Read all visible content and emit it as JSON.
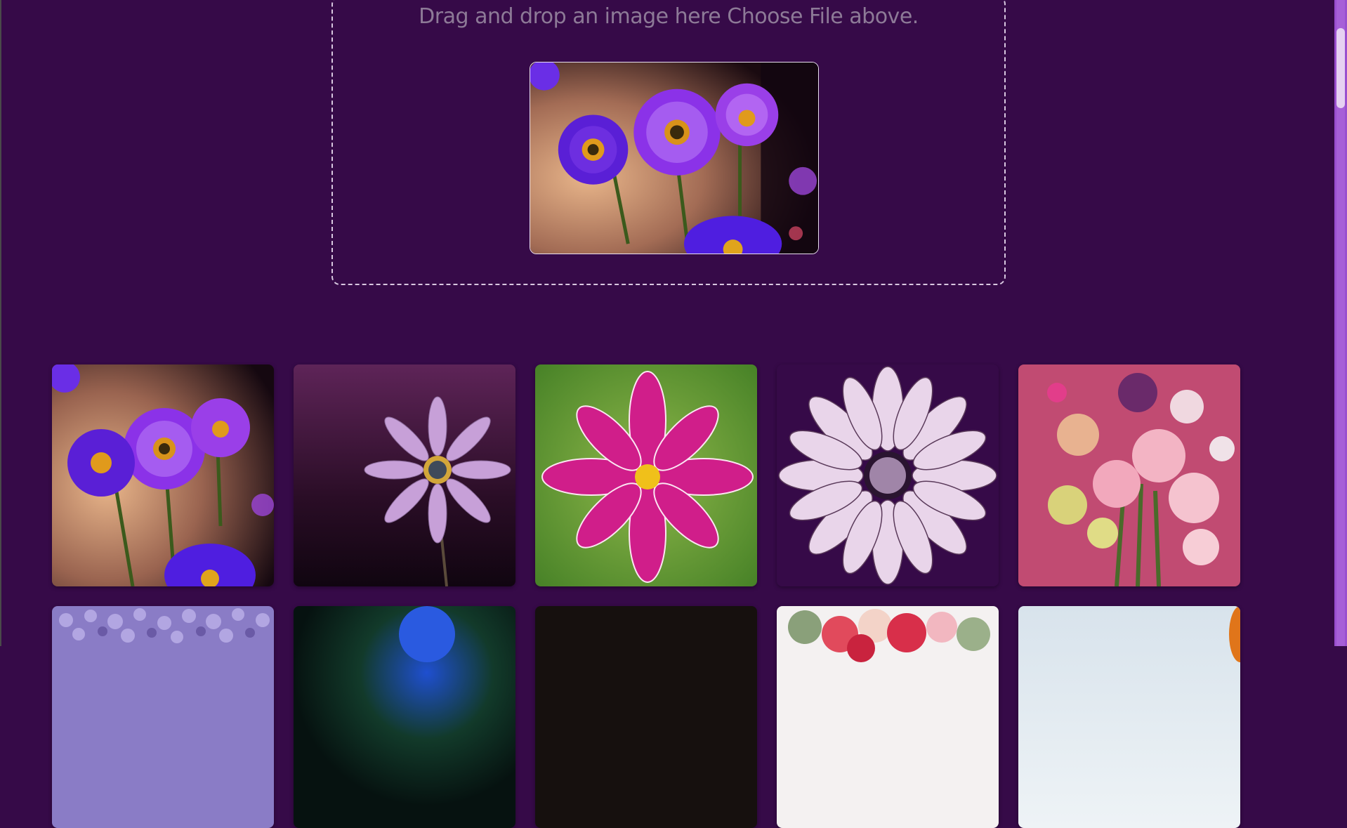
{
  "upload": {
    "drop_text": "Drag and drop an image here Choose File above.",
    "preview_image": "purple-daisies-photo"
  },
  "gallery": {
    "items": [
      {
        "image": "purple-daisies-photo"
      },
      {
        "image": "lavender-daisy-photo"
      },
      {
        "image": "magenta-cosmos-photo"
      },
      {
        "image": "white-daisy-illustration"
      },
      {
        "image": "pink-bouquet-photo"
      },
      {
        "image": "lavender-field-photo"
      },
      {
        "image": "blue-flower-dark-photo"
      },
      {
        "image": "dark-photo"
      },
      {
        "image": "red-roses-photo"
      },
      {
        "image": "sky-flower-photo"
      }
    ]
  },
  "colors": {
    "background": "#360a48",
    "drop_border": "#d8c8e0",
    "drop_text": "#8d7a97",
    "scrollbar": "#9a4fcf"
  }
}
